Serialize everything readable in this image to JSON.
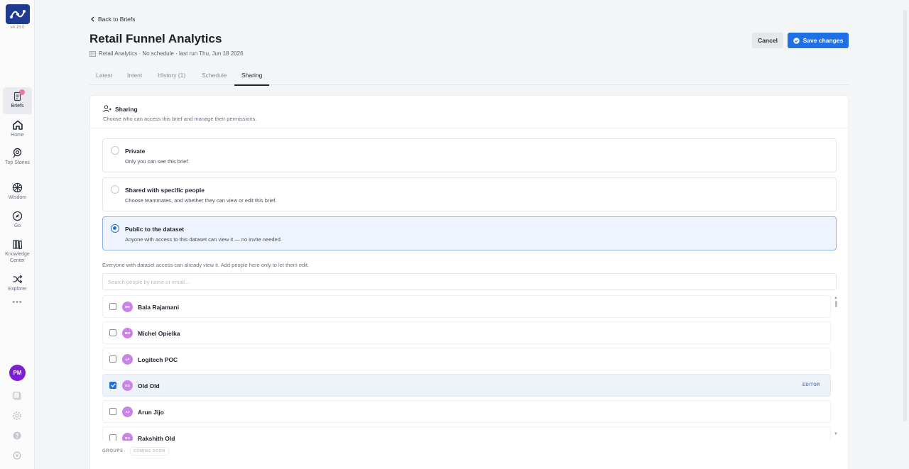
{
  "app": {
    "version": "v4.15.0",
    "colors": {
      "accent": "#1f6fe5",
      "brand": "#1f3b8f",
      "avatar": "#7c1fd1",
      "person_avatar": "#c984e6"
    }
  },
  "sidebar": {
    "items": [
      {
        "label": "Briefs",
        "icon": "briefs-icon",
        "active": true
      },
      {
        "label": "Home",
        "icon": "home-icon"
      },
      {
        "label": "Top Stories",
        "icon": "top-stories-icon"
      },
      {
        "label": "Wisdom",
        "icon": "wisdom-icon"
      },
      {
        "label": "Go",
        "icon": "compass-icon"
      },
      {
        "label": "Knowledge Center",
        "icon": "knowledge-center-icon"
      },
      {
        "label": "Explorer",
        "icon": "shuffle-icon"
      }
    ],
    "more": "•••",
    "user_initials": "PM"
  },
  "header": {
    "back_label": "Back to Briefs",
    "title": "Retail Funnel Analytics",
    "meta": "Retail Analytics · No schedule · last run Thu, Jun 18 2026",
    "cancel_label": "Cancel",
    "save_label": "Save changes"
  },
  "tabs": [
    {
      "label": "Latest"
    },
    {
      "label": "Intent"
    },
    {
      "label": "History (1)"
    },
    {
      "label": "Schedule"
    },
    {
      "label": "Sharing",
      "active": true
    }
  ],
  "sharing": {
    "title": "Sharing",
    "description": "Choose who can access this brief and manage their permissions.",
    "options": [
      {
        "title": "Private",
        "desc": "Only you can see this brief.",
        "selected": false
      },
      {
        "title": "Shared with specific people",
        "desc": "Choose teammates, and whether they can view or edit this brief.",
        "selected": false
      },
      {
        "title": "Public to the dataset",
        "desc": "Anyone with access to this dataset can view it — no invite needed.",
        "selected": true
      }
    ],
    "helper": "Everyone with dataset access can already view it. Add people here only to let them edit.",
    "search_placeholder": "Search people by name or email...",
    "people": [
      {
        "initials": "BR",
        "name": "Bala Rajamani",
        "checked": false,
        "role": ""
      },
      {
        "initials": "MO",
        "name": "Michel Opielka",
        "checked": false,
        "role": ""
      },
      {
        "initials": "LP",
        "name": "Logitech POC",
        "checked": false,
        "role": ""
      },
      {
        "initials": "OO",
        "name": "Old Old",
        "checked": true,
        "role": "EDITOR"
      },
      {
        "initials": "AJ",
        "name": "Arun Jijo",
        "checked": false,
        "role": ""
      },
      {
        "initials": "RO",
        "name": "Rakshith Old",
        "checked": false,
        "role": ""
      }
    ],
    "groups_label": "GROUPS",
    "coming_soon": "COMING SOON"
  }
}
